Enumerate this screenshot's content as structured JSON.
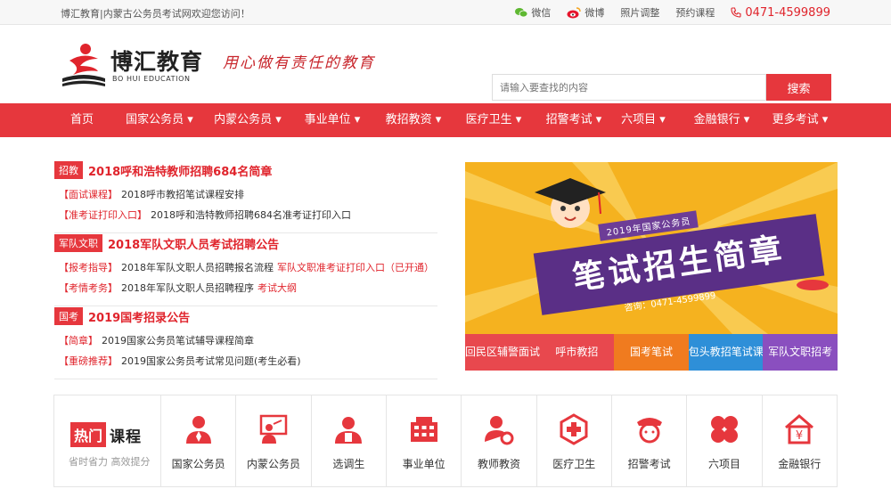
{
  "topbar": {
    "welcome": "博汇教育|内蒙古公务员考试网欢迎您访问！",
    "wechat": "微信",
    "weibo": "微博",
    "photo": "照片调整",
    "booking": "预约课程",
    "phone": "0471-4599899"
  },
  "header": {
    "logo_name": "博汇教育",
    "logo_en": "BO HUI EDUCATION",
    "slogan": "用心做有责任的教育",
    "search_placeholder": "请输入要查找的内容",
    "search_button": "搜索"
  },
  "nav": [
    "首页",
    "国家公务员 ▾",
    "内蒙公务员 ▾",
    "事业单位 ▾",
    "教招教资 ▾",
    "医疗卫生 ▾",
    "招警考试 ▾",
    "六项目 ▾",
    "金融银行 ▾",
    "更多考试 ▾"
  ],
  "news": [
    {
      "tag": "招教",
      "title": "2018呼和浩特教师招聘684名简章",
      "lines": [
        {
          "label": "【面试课程】",
          "text": "2018呼市教招笔试课程安排"
        },
        {
          "label": "【准考证打印入口】",
          "text": "2018呼和浩特教师招聘684名准考证打印入口"
        }
      ]
    },
    {
      "tag": "军队文职",
      "title": "2018军队文职人员考试招聘公告",
      "lines": [
        {
          "label": "【报考指导】",
          "text": "2018年军队文职人员招聘报名流程",
          "extra": "军队文职准考证打印入口（已开通）"
        },
        {
          "label": "【考情考务】",
          "text": "2018年军队文职人员招聘程序",
          "extra": "考试大纲"
        }
      ]
    },
    {
      "tag": "国考",
      "title": "2019国考招录公告",
      "lines": [
        {
          "label": "【简章】",
          "text": "2019国家公务员笔试辅导课程简章"
        },
        {
          "label": "【重磅推荐】",
          "text": "2019国家公务员考试常见问题(考生必看)"
        }
      ]
    }
  ],
  "banner": {
    "caption": "2019年国家公务员",
    "headline": "笔试招生简章",
    "tel": "咨询：0471-4599899",
    "tabs": [
      {
        "label": "回民区辅警面试",
        "color": "#e8484e"
      },
      {
        "label": "呼市教招",
        "color": "#e8484e"
      },
      {
        "label": "国考笔试",
        "color": "#f07b1f"
      },
      {
        "label": "包头教招笔试课",
        "color": "#2e8fd8"
      },
      {
        "label": "军队文职招考",
        "color": "#8a4fbf"
      }
    ]
  },
  "hot": {
    "title_red": "热门",
    "title_black": "课程",
    "subtitle": "省时省力 高效提分",
    "items": [
      {
        "label": "国家公务员",
        "icon": "civil-servant-icon"
      },
      {
        "label": "内蒙公务员",
        "icon": "teacher-board-icon"
      },
      {
        "label": "选调生",
        "icon": "selected-graduate-icon"
      },
      {
        "label": "事业单位",
        "icon": "building-icon"
      },
      {
        "label": "教师教资",
        "icon": "teacher-gear-icon"
      },
      {
        "label": "医疗卫生",
        "icon": "medical-icon"
      },
      {
        "label": "招警考试",
        "icon": "police-icon"
      },
      {
        "label": "六项目",
        "icon": "clover-icon"
      },
      {
        "label": "金融银行",
        "icon": "bank-icon"
      }
    ],
    "accent": "#e6373d"
  }
}
